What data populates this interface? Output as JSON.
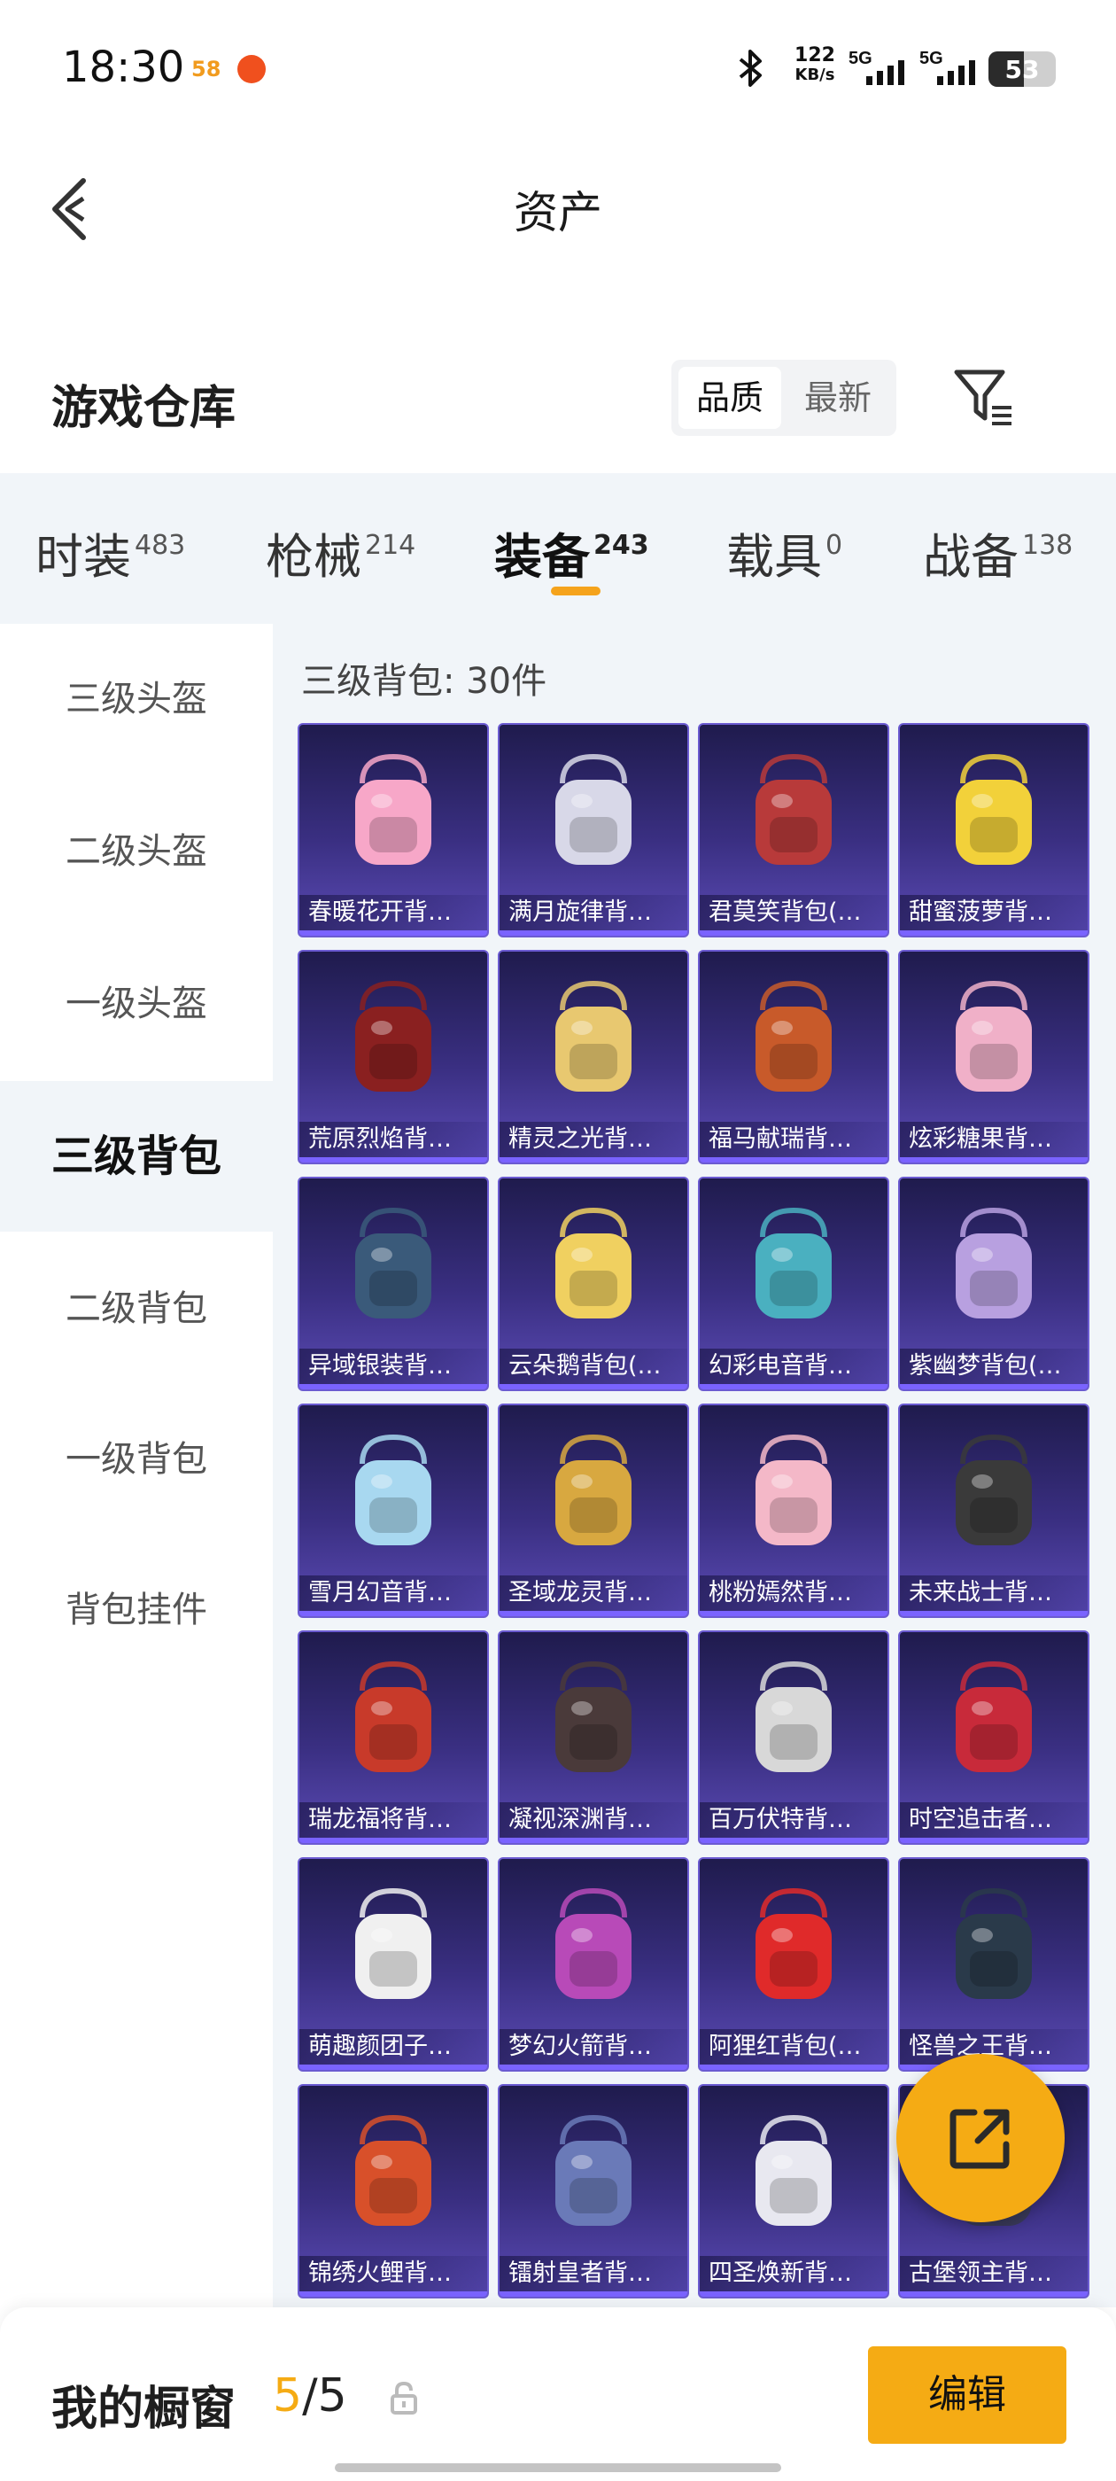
{
  "status_bar": {
    "time": "18:30",
    "app_badge_1": "58",
    "net_speed": "122",
    "net_speed_unit": "KB/s",
    "signal_1": "5G",
    "signal_2": "5G",
    "battery": "53",
    "battery_level": 0.53
  },
  "header": {
    "title": "资产",
    "back_icon": "chevron-left-icon"
  },
  "warehouse": {
    "title": "游戏仓库",
    "sort_options": [
      "品质",
      "最新"
    ],
    "sort_selected": "品质",
    "filter_icon": "filter-icon"
  },
  "tabs": [
    {
      "label": "时装",
      "count": "483"
    },
    {
      "label": "枪械",
      "count": "214"
    },
    {
      "label": "装备",
      "count": "243",
      "active": true
    },
    {
      "label": "载具",
      "count": "0"
    },
    {
      "label": "战备",
      "count": "138"
    }
  ],
  "sidebar": {
    "items": [
      "三级头盔",
      "二级头盔",
      "一级头盔",
      "三级背包",
      "二级背包",
      "一级背包",
      "背包挂件"
    ],
    "active": "三级背包"
  },
  "content": {
    "count_label": "三级背包: 30件",
    "items": [
      "春暖花开背…",
      "满月旋律背…",
      "君莫笑背包(…",
      "甜蜜菠萝背…",
      "荒原烈焰背…",
      "精灵之光背…",
      "福马献瑞背…",
      "炫彩糖果背…",
      "异域银装背…",
      "云朵鹅背包(…",
      "幻彩电音背…",
      "紫幽梦背包(…",
      "雪月幻音背…",
      "圣域龙灵背…",
      "桃粉嫣然背…",
      "未来战士背…",
      "瑞龙福将背…",
      "凝视深渊背…",
      "百万伏特背…",
      "时空追击者…",
      "萌趣颜团子…",
      "梦幻火箭背…",
      "阿狸红背包(…",
      "怪兽之王背…",
      "锦绣火鲤背…",
      "镭射皇者背…",
      "四圣焕新背…",
      "古堡领主背…"
    ],
    "art_colors": [
      "#f7a7c8",
      "#d8d8e8",
      "#b83a3a",
      "#f2d13a",
      "#8a2020",
      "#e8c870",
      "#c85a2a",
      "#f0b0c8",
      "#3a5a7a",
      "#f0d060",
      "#4ab0c0",
      "#b8a0e0",
      "#a8d8f0",
      "#d8a840",
      "#f4b8c8",
      "#3a3a3a",
      "#c83a2a",
      "#4a3a3a",
      "#d8d8d8",
      "#c82a3a",
      "#f0f0f0",
      "#b84ab8",
      "#e02a2a",
      "#2a3a4a",
      "#d8502a",
      "#6a7ab8",
      "#e8e8f0",
      "#3a3a5a"
    ]
  },
  "fab": {
    "icon": "share-icon"
  },
  "bottom": {
    "label": "我的橱窗",
    "current": "5",
    "separator": "/",
    "total": "5",
    "lock_icon": "lock-icon",
    "edit_label": "编辑"
  }
}
